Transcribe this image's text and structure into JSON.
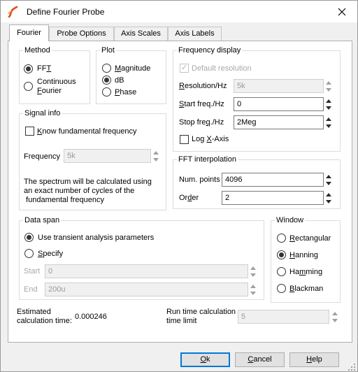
{
  "window": {
    "title": "Define Fourier Probe",
    "app_icon": "squiggle-icon",
    "close_icon": "close-icon"
  },
  "tabs": [
    {
      "label": "Fourier",
      "active": true
    },
    {
      "label": "Probe Options",
      "active": false
    },
    {
      "label": "Axis Scales",
      "active": false
    },
    {
      "label": "Axis Labels",
      "active": false
    }
  ],
  "method": {
    "legend": "Method",
    "fft": {
      "prefix": "FF",
      "mnemonic": "T",
      "checked": true
    },
    "continuous": {
      "line1": "Continuous",
      "line2_mnemonic": "F",
      "line2_rest": "ourier",
      "checked": false
    }
  },
  "plot": {
    "legend": "Plot",
    "magnitude": {
      "mnemonic": "M",
      "rest": "agnitude",
      "checked": false
    },
    "db": {
      "label": "dB",
      "checked": true
    },
    "phase": {
      "mnemonic": "P",
      "rest": "hase",
      "checked": false
    }
  },
  "frequency_display": {
    "legend": "Frequency display",
    "default_resolution": {
      "label": "Default resolution",
      "checked": true,
      "enabled": false
    },
    "resolution": {
      "mnemonic": "R",
      "rest": "esolution/Hz",
      "value": "5k",
      "enabled": false
    },
    "start_freq": {
      "mnemonic": "S",
      "rest": "tart freq./Hz",
      "value": "0"
    },
    "stop_freq": {
      "prefix": "Stop fre",
      "mnemonic": "q",
      "rest": "./Hz",
      "value": "2Meg"
    },
    "log_x": {
      "prefix": "Log ",
      "mnemonic": "X",
      "rest": "-Axis",
      "checked": false
    }
  },
  "signal_info": {
    "legend": "Signal info",
    "know_fundamental": {
      "mnemonic": "K",
      "rest": "now fundamental frequency",
      "checked": false
    },
    "frequency": {
      "label": "Frequency",
      "value": "5k",
      "enabled": false
    },
    "description": [
      "The spectrum will be calculated using",
      "an exact number of cycles of the",
      " fundamental frequency"
    ]
  },
  "fft_interpolation": {
    "legend": "FFT interpolation",
    "num_points": {
      "label": "Num. points",
      "value": "4096"
    },
    "order": {
      "prefix": "Or",
      "mnemonic": "d",
      "rest": "er",
      "value": "2"
    }
  },
  "data_span": {
    "legend": "Data span",
    "use_transient": {
      "label": "Use transient analysis parameters",
      "checked": true
    },
    "specify": {
      "mnemonic": "S",
      "rest": "pecify",
      "checked": false
    },
    "start": {
      "label": "Start",
      "value": "0",
      "enabled": false
    },
    "end": {
      "label": "End",
      "value": "200u",
      "enabled": false
    }
  },
  "window_fn": {
    "legend": "Window",
    "rectangular": {
      "mnemonic": "R",
      "rest": "ectangular",
      "checked": false
    },
    "hanning": {
      "mnemonic": "H",
      "rest": "anning",
      "checked": true
    },
    "hamming": {
      "prefix": "Ha",
      "mnemonic": "m",
      "rest": "ming",
      "checked": false
    },
    "blackman": {
      "mnemonic": "B",
      "rest": "lackman",
      "checked": false
    }
  },
  "estimated": {
    "label_line1": "Estimated",
    "label_line2": "calculation time:",
    "value": "0.000246"
  },
  "run_time_limit": {
    "label_line1": "Run time calculation",
    "label_line2": "time limit",
    "value": "5",
    "enabled": false
  },
  "buttons": {
    "ok": {
      "mnemonic": "O",
      "rest": "k"
    },
    "cancel": {
      "mnemonic": "C",
      "rest": "ancel"
    },
    "help": {
      "mnemonic": "H",
      "rest": "elp"
    }
  },
  "colors": {
    "focus_accent": "#0078d7",
    "app_icon": "#e8431c",
    "panel": "#ffffff",
    "chrome": "#f0f0f0"
  }
}
